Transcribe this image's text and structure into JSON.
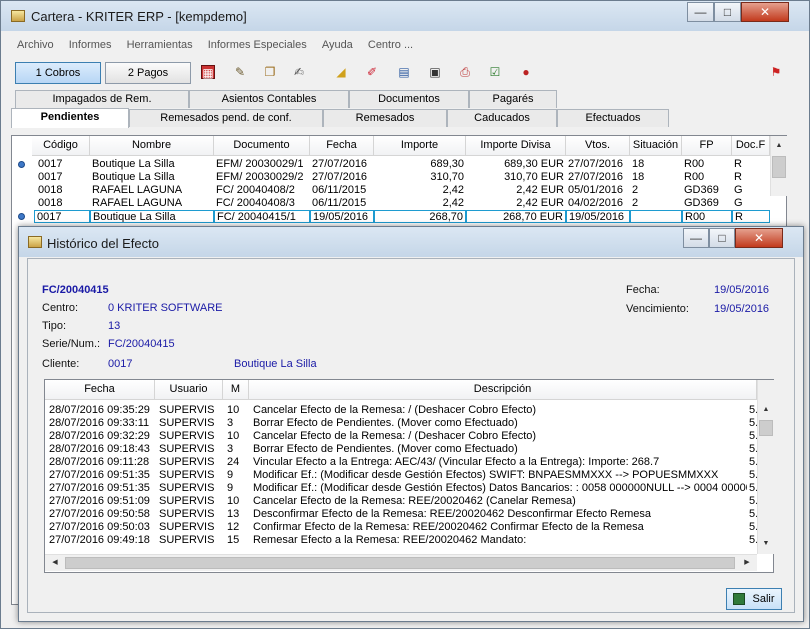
{
  "main": {
    "title": "Cartera - KRITER ERP - [kempdemo]",
    "minimize": "—",
    "maximize": "□",
    "close": "✕",
    "menu": [
      "Archivo",
      "Informes",
      "Herramientas",
      "Informes Especiales",
      "Ayuda",
      "Centro ..."
    ],
    "btn_cobros": "1 Cobros",
    "btn_pagos": "2 Pagos",
    "tabs_row1": [
      "Impagados de Rem.",
      "Asientos Contables",
      "Documentos",
      "Pagarés"
    ],
    "tabs_row2": [
      "Pendientes",
      "Remesados pend. de conf.",
      "Remesados",
      "Caducados",
      "Efectuados"
    ],
    "columns": [
      "Código",
      "Nombre",
      "Documento",
      "Fecha",
      "Importe",
      "Importe Divisa",
      "Vtos.",
      "Situación",
      "FP",
      "Doc.F"
    ],
    "rows": [
      {
        "codigo": "0017",
        "nombre": "Boutique La Silla",
        "documento": "EFM/ 20030029/1",
        "fecha": "27/07/2016",
        "importe": "689,30",
        "divisa": "689,30 EUR",
        "vtos": "27/07/2016",
        "situacion": "18",
        "fp": "R00",
        "docf": "R"
      },
      {
        "codigo": "0017",
        "nombre": "Boutique La Silla",
        "documento": "EFM/ 20030029/2",
        "fecha": "27/07/2016",
        "importe": "310,70",
        "divisa": "310,70 EUR",
        "vtos": "27/07/2016",
        "situacion": "18",
        "fp": "R00",
        "docf": "R"
      },
      {
        "codigo": "0018",
        "nombre": "RAFAEL LAGUNA",
        "documento": "FC/ 20040408/2",
        "fecha": "06/11/2015",
        "importe": "2,42",
        "divisa": "2,42 EUR",
        "vtos": "05/01/2016",
        "situacion": "2",
        "fp": "GD369",
        "docf": "G"
      },
      {
        "codigo": "0018",
        "nombre": "RAFAEL LAGUNA",
        "documento": "FC/ 20040408/3",
        "fecha": "06/11/2015",
        "importe": "2,42",
        "divisa": "2,42 EUR",
        "vtos": "04/02/2016",
        "situacion": "2",
        "fp": "GD369",
        "docf": "G"
      },
      {
        "codigo": "0017",
        "nombre": "Boutique La Silla",
        "documento": "FC/ 20040415/1",
        "fecha": "19/05/2016",
        "importe": "268,70",
        "divisa": "268,70 EUR",
        "vtos": "19/05/2016",
        "situacion": "",
        "fp": "R00",
        "docf": "R"
      }
    ]
  },
  "dialog": {
    "title": "Histórico del Efecto",
    "minimize": "—",
    "maximize": "□",
    "close": "✕",
    "doc_id": "FC/20040415",
    "centro_label": "Centro:",
    "centro_value": "0  KRITER SOFTWARE",
    "tipo_label": "Tipo:",
    "tipo_value": "13",
    "serie_label": "Serie/Num.:",
    "serie_value": "FC/20040415",
    "cliente_label": "Cliente:",
    "cliente_code": "0017",
    "cliente_name": "Boutique La Silla",
    "fecha_label": "Fecha:",
    "fecha_value": "19/05/2016",
    "venc_label": "Vencimiento:",
    "venc_value": "19/05/2016",
    "columns": [
      "Fecha",
      "Usuario",
      "M",
      "Descripción"
    ],
    "rows": [
      {
        "fecha": "28/07/2016 09:35:29",
        "usuario": "SUPERVIS",
        "m": "10",
        "desc": "Cancelar Efecto de la Remesa: / (Deshacer Cobro Efecto)",
        "end": "5."
      },
      {
        "fecha": "28/07/2016 09:33:11",
        "usuario": "SUPERVIS",
        "m": "3",
        "desc": "Borrar Efecto de Pendientes. (Mover como Efectuado)",
        "end": "5."
      },
      {
        "fecha": "28/07/2016 09:32:29",
        "usuario": "SUPERVIS",
        "m": "10",
        "desc": "Cancelar Efecto de la Remesa: / (Deshacer Cobro Efecto)",
        "end": "5."
      },
      {
        "fecha": "28/07/2016 09:18:43",
        "usuario": "SUPERVIS",
        "m": "3",
        "desc": "Borrar Efecto de Pendientes. (Mover como Efectuado)",
        "end": "5."
      },
      {
        "fecha": "28/07/2016 09:11:28",
        "usuario": "SUPERVIS",
        "m": "24",
        "desc": "Vincular Efecto a la Entrega: AEC/43/ (Vincular Efecto a la Entrega): Importe: 268.7",
        "end": "5."
      },
      {
        "fecha": "27/07/2016 09:51:35",
        "usuario": "SUPERVIS",
        "m": "9",
        "desc": "Modificar Ef.: (Modificar desde Gestión Efectos) SWIFT: BNPAESMMXXX --> POPUESMMXXX",
        "end": "5."
      },
      {
        "fecha": "27/07/2016 09:51:35",
        "usuario": "SUPERVIS",
        "m": "9",
        "desc": "Modificar Ef.: (Modificar desde Gestión Efectos) Datos Bancarios: : 0058 000000NULL --> 0004 000000N",
        "end": "5."
      },
      {
        "fecha": "27/07/2016 09:51:09",
        "usuario": "SUPERVIS",
        "m": "10",
        "desc": "Cancelar Efecto de la Remesa: REE/20020462 (Canelar Remesa)",
        "end": "5."
      },
      {
        "fecha": "27/07/2016 09:50:58",
        "usuario": "SUPERVIS",
        "m": "13",
        "desc": "Desconfirmar Efecto de la Remesa: REE/20020462 Desconfirmar Efecto Remesa",
        "end": "5."
      },
      {
        "fecha": "27/07/2016 09:50:03",
        "usuario": "SUPERVIS",
        "m": "12",
        "desc": "Confirmar Efecto de la Remesa: REE/20020462 Confirmar Efecto de la Remesa",
        "end": "5."
      },
      {
        "fecha": "27/07/2016 09:49:18",
        "usuario": "SUPERVIS",
        "m": "15",
        "desc": "Remesar Efecto a la Remesa: REE/20020462 Mandato:",
        "end": "5."
      }
    ],
    "btn_salir": "Salir"
  }
}
